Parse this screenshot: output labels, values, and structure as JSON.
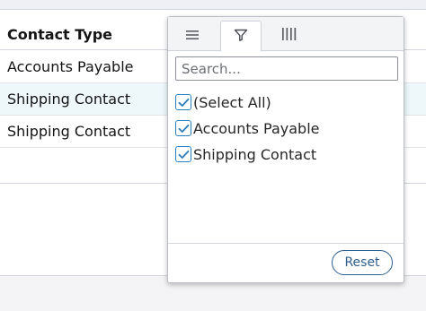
{
  "grid": {
    "column_header": "Contact Type",
    "rows": [
      {
        "contact_type": "Accounts Payable"
      },
      {
        "contact_type": "Shipping Contact"
      },
      {
        "contact_type": "Shipping Contact"
      }
    ]
  },
  "filter_popup": {
    "tabs": [
      {
        "icon": "menu-icon",
        "active": false
      },
      {
        "icon": "filter-icon",
        "active": true
      },
      {
        "icon": "columns-icon",
        "active": false
      }
    ],
    "search": {
      "placeholder": "Search...",
      "value": ""
    },
    "items": [
      {
        "label": "(Select All)",
        "checked": true
      },
      {
        "label": "Accounts Payable",
        "checked": true
      },
      {
        "label": "Shipping Contact",
        "checked": true
      }
    ],
    "reset_label": "Reset"
  },
  "colors": {
    "accent": "#2c7fbf",
    "row_highlight": "#eef8fb",
    "reset_border": "#2f5f8f"
  }
}
